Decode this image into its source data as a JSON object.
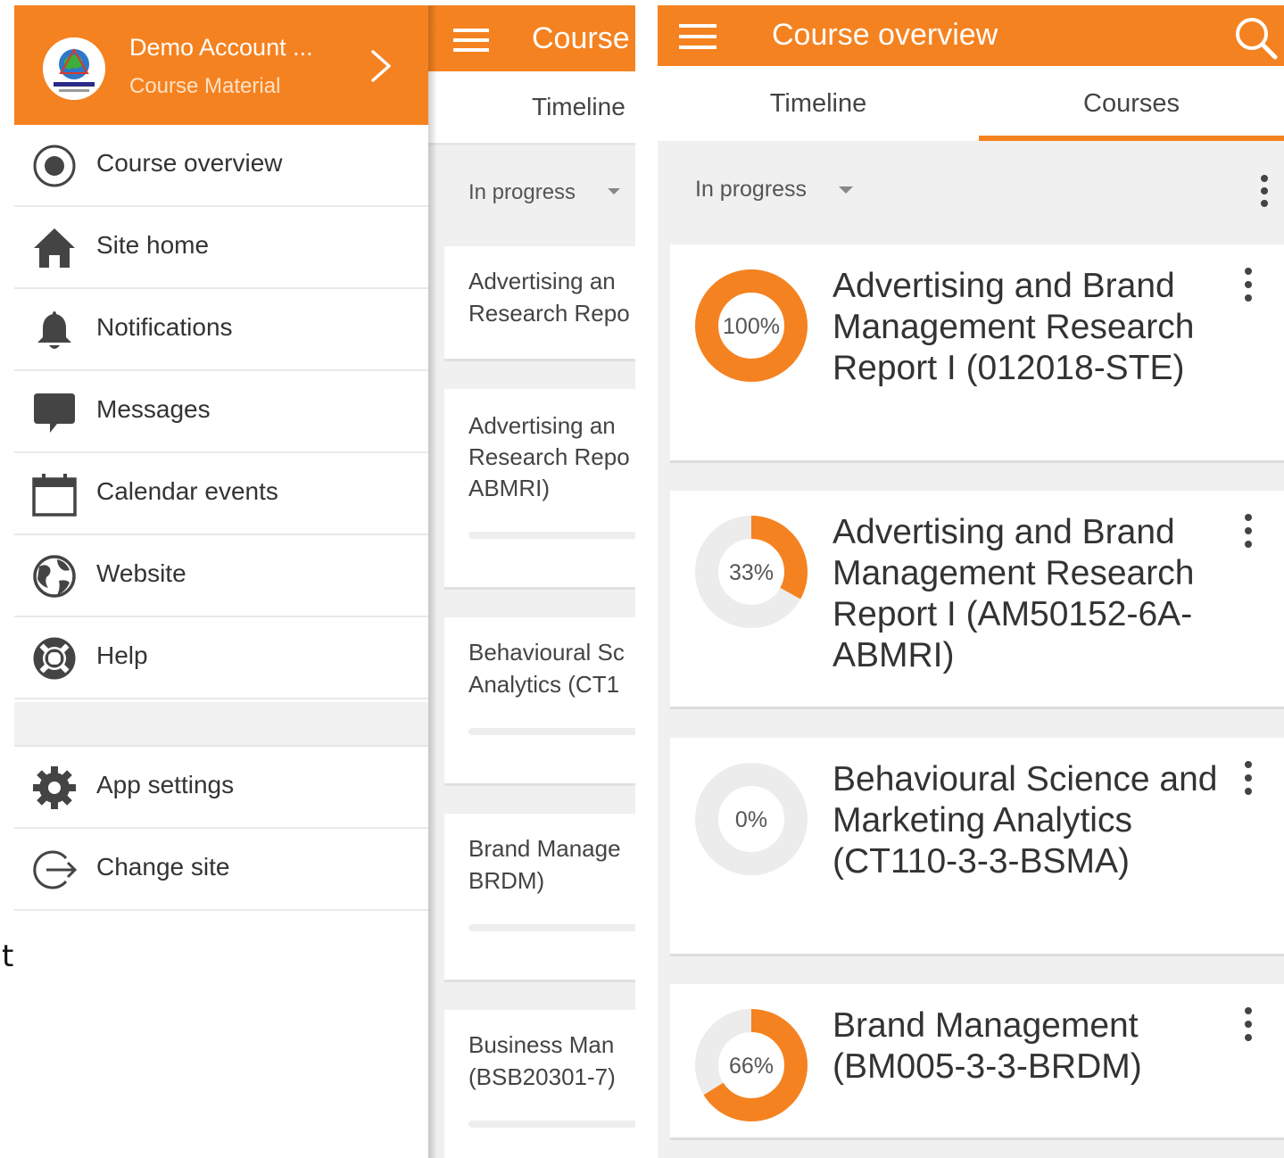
{
  "colors": {
    "accent": "#f58220",
    "ring_track": "#ececec",
    "text": "#333333"
  },
  "drawer": {
    "account_name": "Demo Account ...",
    "site_name": "Course Material",
    "menu": [
      {
        "label": "Course overview",
        "icon": "course-overview-icon"
      },
      {
        "label": "Site home",
        "icon": "home-icon"
      },
      {
        "label": "Notifications",
        "icon": "bell-icon"
      },
      {
        "label": "Messages",
        "icon": "chat-bubble-icon"
      },
      {
        "label": "Calendar events",
        "icon": "calendar-icon"
      },
      {
        "label": "Website",
        "icon": "globe-icon"
      },
      {
        "label": "Help",
        "icon": "lifebuoy-icon"
      }
    ],
    "settings_menu": [
      {
        "label": "App settings",
        "icon": "gear-icon"
      },
      {
        "label": "Change site",
        "icon": "logout-icon"
      }
    ]
  },
  "background_app": {
    "title": "Course",
    "tab": "Timeline",
    "filter": "In progress",
    "cards": [
      {
        "lines": [
          "Advertising an",
          "Research Repo"
        ]
      },
      {
        "lines": [
          "Advertising an",
          "Research Repo",
          "ABMRI)"
        ]
      },
      {
        "lines": [
          "Behavioural Sc",
          "Analytics (CT1"
        ]
      },
      {
        "lines": [
          "Brand Manage",
          "BRDM)"
        ]
      },
      {
        "lines": [
          "Business Man",
          "(BSB20301-7)"
        ]
      }
    ]
  },
  "stray_text": "t",
  "overview": {
    "title": "Course overview",
    "tabs": [
      "Timeline",
      "Courses"
    ],
    "active_tab": 1,
    "filter": "In progress",
    "courses": [
      {
        "name": "Advertising and Brand Management Research Report I (012018-STE)",
        "progress": 100,
        "progress_label": "100%"
      },
      {
        "name": "Advertising and Brand Management Research Report I (AM50152-6A-ABMRI)",
        "progress": 33,
        "progress_label": "33%"
      },
      {
        "name": "Behavioural Science and Marketing Analytics (CT110-3-3-BSMA)",
        "progress": 0,
        "progress_label": "0%"
      },
      {
        "name": "Brand Management (BM005-3-3-BRDM)",
        "progress": 66,
        "progress_label": "66%"
      }
    ]
  }
}
